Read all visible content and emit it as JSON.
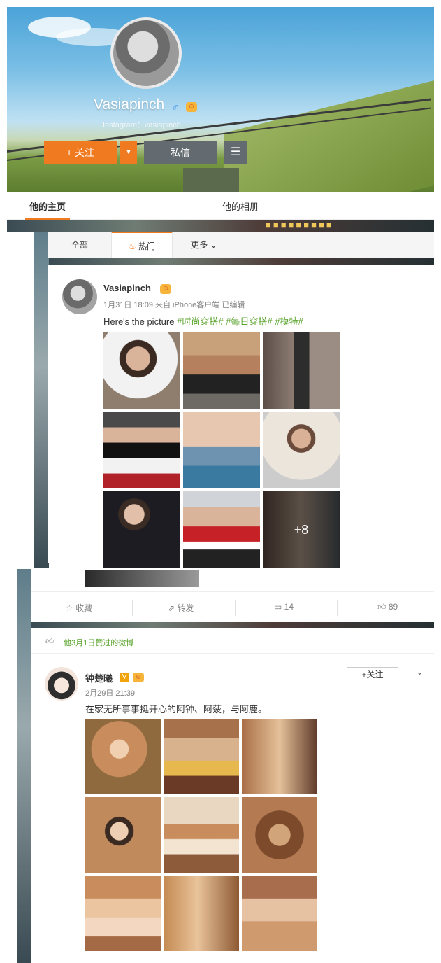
{
  "profile": {
    "name": "Vasiapinch",
    "gender_icon": "♂",
    "instagram": "Instagram：vasiapinch",
    "follow_label": "+ 关注",
    "dropdown_icon": "▼",
    "message_label": "私信",
    "menu_icon": "☰"
  },
  "tabs": {
    "home": "他的主页",
    "album": "他的相册"
  },
  "filter": {
    "all": "全部",
    "hot": "热门",
    "more": "更多"
  },
  "post1": {
    "author": "Vasiapinch",
    "meta": "1月31日 18:09 来自 iPhone客户端  已编辑",
    "text": "Here's the picture ",
    "tags": "#时尚穿搭# #每日穿搭# #模特#",
    "more_count": "+8"
  },
  "actions": {
    "collect": "收藏",
    "repost": "转发",
    "comment_count": "14",
    "like_count": "89"
  },
  "liked": {
    "label": "他3月1日赞过的微博"
  },
  "post2": {
    "author": "钟楚曦",
    "verified_icon": "V",
    "meta": "2月29日 21:39",
    "text": "在家无所事事挺开心的阿钟、阿菠，与阿鹿。",
    "follow_label": "+关注"
  },
  "colors": {
    "accent": "#f07a20",
    "tag_green": "#5aa32c",
    "button_gray": "#636b70"
  }
}
